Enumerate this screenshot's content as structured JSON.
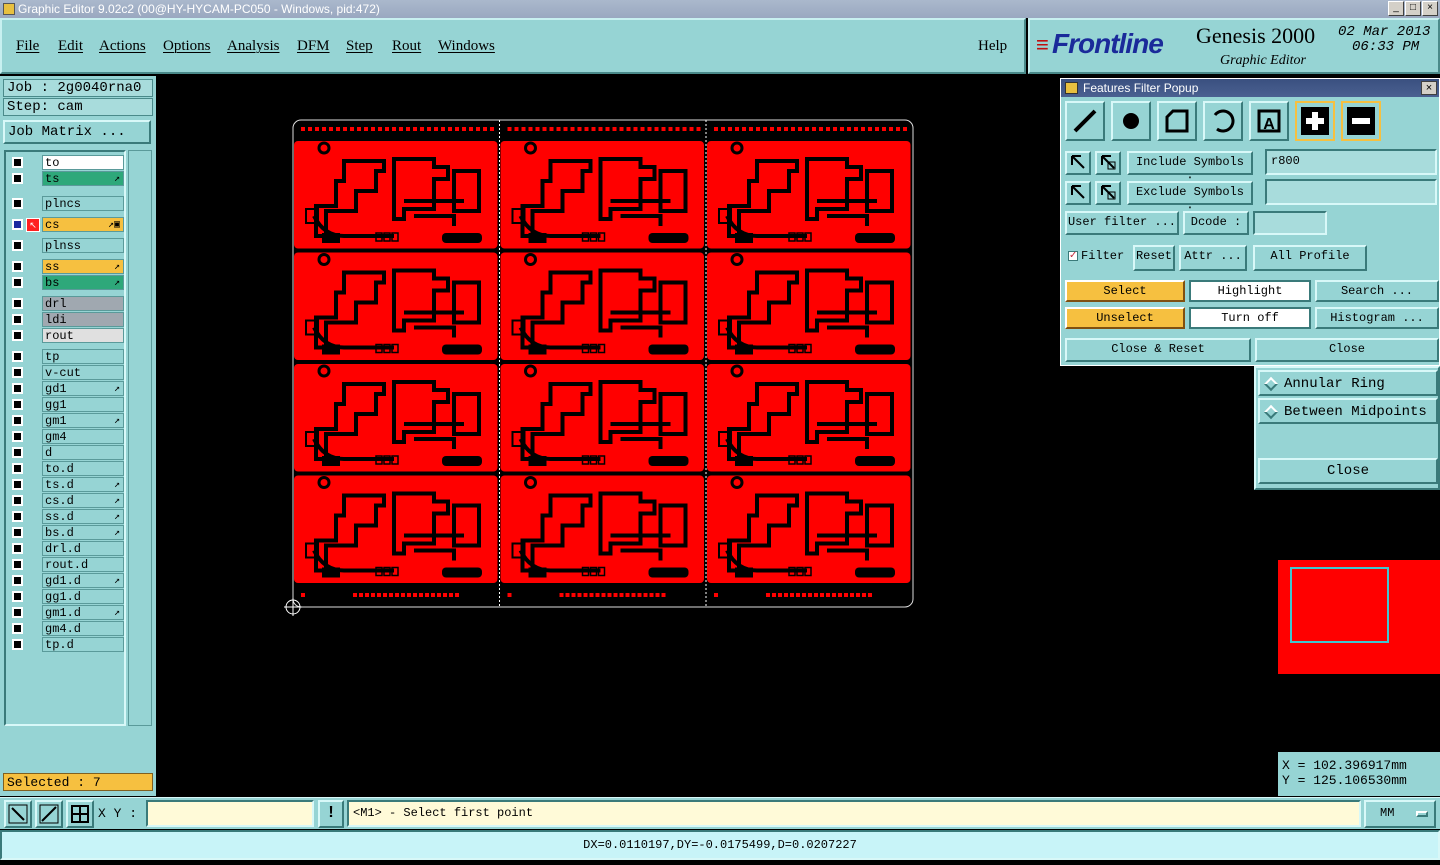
{
  "window": {
    "title": "Graphic Editor 9.02c2 (00@HY-HYCAM-PC050 - Windows, pid:472)",
    "controls": [
      "_",
      "□",
      "×"
    ]
  },
  "menu": {
    "items": [
      "File",
      "Edit",
      "Actions",
      "Options",
      "Analysis",
      "DFM",
      "Step",
      "Rout",
      "Windows"
    ],
    "help": "Help"
  },
  "brand": {
    "logo": "Frontline",
    "product": "Genesis 2000",
    "subtitle": "Graphic Editor",
    "date": "02 Mar 2013",
    "time": "06:33 PM"
  },
  "job": {
    "job_line": "Job : 2g0040rna0",
    "step_line": "Step: cam",
    "matrix_button": "Job Matrix ..."
  },
  "layers": [
    {
      "name": "to",
      "bg": "#ffffff",
      "mark": ""
    },
    {
      "name": "ts",
      "bg": "#2ea87a",
      "mark": "↗"
    },
    {
      "name": "plncs",
      "bg": "#96d4d4",
      "mark": ""
    },
    {
      "name": "cs",
      "bg": "#f6c040",
      "mark": "↗▣"
    },
    {
      "name": "plnss",
      "bg": "#96d4d4",
      "mark": ""
    },
    {
      "name": "ss",
      "bg": "#f6c040",
      "mark": "↗"
    },
    {
      "name": "bs",
      "bg": "#2ea87a",
      "mark": "↗"
    },
    {
      "name": "drl",
      "bg": "#a0a8b0",
      "mark": ""
    },
    {
      "name": "ldi",
      "bg": "#a0a8b0",
      "mark": ""
    },
    {
      "name": "rout",
      "bg": "#e0e0e0",
      "mark": ""
    },
    {
      "name": "tp",
      "bg": "#96d4d4",
      "mark": ""
    },
    {
      "name": "v-cut",
      "bg": "#96d4d4",
      "mark": ""
    },
    {
      "name": "gd1",
      "bg": "#96d4d4",
      "mark": "↗"
    },
    {
      "name": "gg1",
      "bg": "#96d4d4",
      "mark": ""
    },
    {
      "name": "gm1",
      "bg": "#96d4d4",
      "mark": "↗"
    },
    {
      "name": "gm4",
      "bg": "#96d4d4",
      "mark": ""
    },
    {
      "name": "d",
      "bg": "#96d4d4",
      "mark": ""
    },
    {
      "name": "to.d",
      "bg": "#96d4d4",
      "mark": ""
    },
    {
      "name": "ts.d",
      "bg": "#96d4d4",
      "mark": "↗"
    },
    {
      "name": "cs.d",
      "bg": "#96d4d4",
      "mark": "↗"
    },
    {
      "name": "ss.d",
      "bg": "#96d4d4",
      "mark": "↗"
    },
    {
      "name": "bs.d",
      "bg": "#96d4d4",
      "mark": "↗"
    },
    {
      "name": "drl.d",
      "bg": "#96d4d4",
      "mark": ""
    },
    {
      "name": "rout.d",
      "bg": "#96d4d4",
      "mark": ""
    },
    {
      "name": "gd1.d",
      "bg": "#96d4d4",
      "mark": "↗"
    },
    {
      "name": "gg1.d",
      "bg": "#96d4d4",
      "mark": ""
    },
    {
      "name": "gm1.d",
      "bg": "#96d4d4",
      "mark": "↗"
    },
    {
      "name": "gm4.d",
      "bg": "#96d4d4",
      "mark": ""
    },
    {
      "name": "tp.d",
      "bg": "#96d4d4",
      "mark": ""
    }
  ],
  "selected_count": "Selected : 7",
  "filter_popup": {
    "title": "Features Filter Popup",
    "include_label": "Include Symbols :",
    "include_value": "r800",
    "exclude_label": "Exclude Symbols :",
    "exclude_value": "",
    "user_filter": "User filter ...",
    "dcode_label": "Dcode :",
    "dcode_value": "",
    "filter_toggle": "Filter",
    "reset": "Reset",
    "attr": "Attr ...",
    "profile": "All Profile",
    "select": "Select",
    "highlight": "Highlight",
    "search": "Search ...",
    "unselect": "Unselect",
    "turn_off": "Turn off",
    "histogram": "Histogram ...",
    "close_reset": "Close & Reset",
    "close": "Close"
  },
  "side_panel": {
    "options": [
      "Annular Ring",
      "Between Midpoints"
    ],
    "close": "Close"
  },
  "coordinates": {
    "x": "X = 102.396917mm",
    "y": "Y = 125.106530mm"
  },
  "bottom": {
    "xy_label": "X Y :",
    "xy_value": "",
    "message": "<M1> - Select first point",
    "units": "MM"
  },
  "status": "DX=0.0110197,DY=-0.0175499,D=0.0207227",
  "colors": {
    "panel": "#96d4d4",
    "copper": "#ff0000",
    "highlight": "#f6c040"
  }
}
